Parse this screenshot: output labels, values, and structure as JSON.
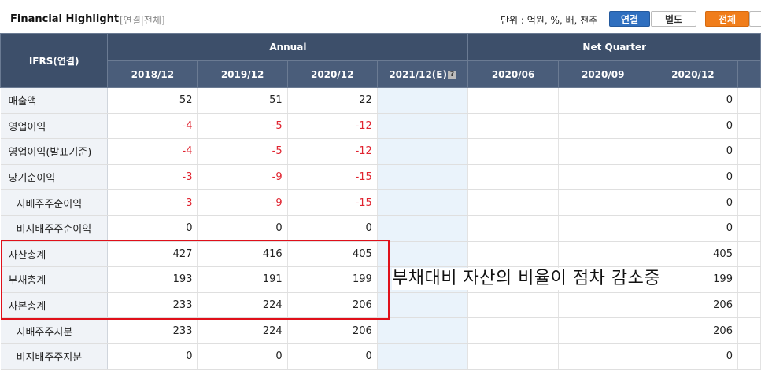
{
  "header": {
    "title": "Financial Highlight",
    "subtitle": "[연결|전체]",
    "unit": "단위 : 억원, %, 배, 천주",
    "btn_consolidated": "연결",
    "btn_separate": "별도",
    "btn_all": "전체"
  },
  "table": {
    "corner": "IFRS(연결)",
    "group_annual": "Annual",
    "group_quarter": "Net Quarter",
    "columns": [
      "2018/12",
      "2019/12",
      "2020/12",
      "2021/12(E)",
      "2020/06",
      "2020/09",
      "2020/12"
    ],
    "estimate_icon": "?",
    "rows": [
      {
        "label": "매출액",
        "sub": false,
        "values": [
          "52",
          "51",
          "22",
          "",
          "",
          "",
          "0"
        ]
      },
      {
        "label": "영업이익",
        "sub": false,
        "values": [
          "-4",
          "-5",
          "-12",
          "",
          "",
          "",
          "0"
        ]
      },
      {
        "label": "영업이익(발표기준)",
        "sub": false,
        "values": [
          "-4",
          "-5",
          "-12",
          "",
          "",
          "",
          "0"
        ]
      },
      {
        "label": "당기순이익",
        "sub": false,
        "values": [
          "-3",
          "-9",
          "-15",
          "",
          "",
          "",
          "0"
        ]
      },
      {
        "label": "지배주주순이익",
        "sub": true,
        "values": [
          "-3",
          "-9",
          "-15",
          "",
          "",
          "",
          "0"
        ]
      },
      {
        "label": "비지배주주순이익",
        "sub": true,
        "values": [
          "0",
          "0",
          "0",
          "",
          "",
          "",
          "0"
        ]
      },
      {
        "label": "자산총계",
        "sub": false,
        "values": [
          "427",
          "416",
          "405",
          "",
          "",
          "",
          "405"
        ]
      },
      {
        "label": "부채총계",
        "sub": false,
        "values": [
          "193",
          "191",
          "199",
          "",
          "",
          "",
          "199"
        ]
      },
      {
        "label": "자본총계",
        "sub": false,
        "values": [
          "233",
          "224",
          "206",
          "",
          "",
          "",
          "206"
        ]
      },
      {
        "label": "지배주주지분",
        "sub": true,
        "values": [
          "233",
          "224",
          "206",
          "",
          "",
          "",
          "206"
        ]
      },
      {
        "label": "비지배주주지분",
        "sub": true,
        "values": [
          "0",
          "0",
          "0",
          "",
          "",
          "",
          "0"
        ]
      }
    ]
  },
  "annotation": "부채대비 자산의 비율이 점차 감소중",
  "colors": {
    "header_bg": "#3d4f6a",
    "negative": "#e0232f",
    "estimate_bg": "#eaf3fb",
    "highlight_box": "#e0101a",
    "btn_consolidated": "#2f6fbf",
    "btn_all": "#f07d1b"
  }
}
